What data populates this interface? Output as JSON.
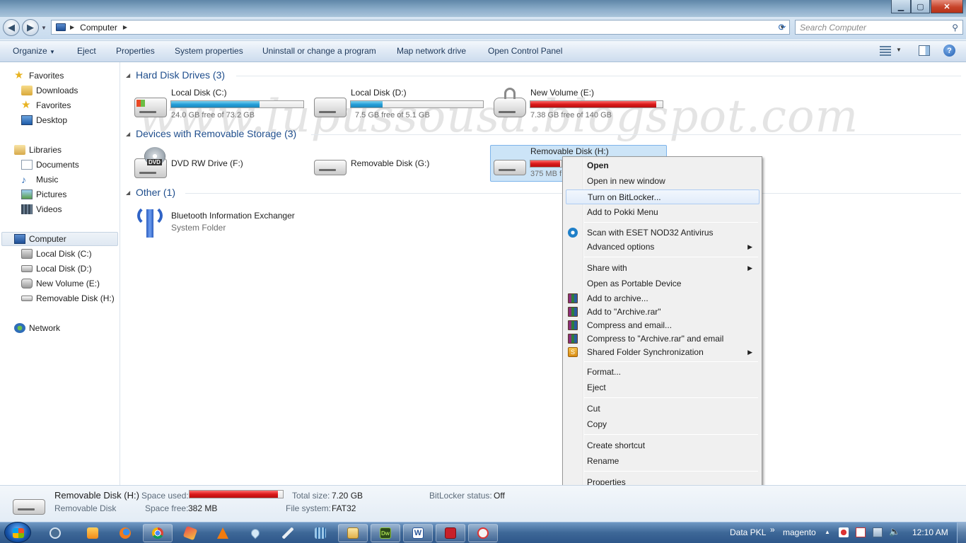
{
  "window": {
    "minimize_glyph": "▁",
    "maximize_glyph": "▢",
    "close_glyph": "✕"
  },
  "address": {
    "back_glyph": "◀",
    "forward_glyph": "▶",
    "path_label": "Computer",
    "search_placeholder": "Search Computer"
  },
  "toolbar": {
    "organize": "Organize",
    "eject": "Eject",
    "properties": "Properties",
    "system_properties": "System properties",
    "uninstall": "Uninstall or change a program",
    "map_drive": "Map network drive",
    "control_panel": "Open Control Panel",
    "help_glyph": "?"
  },
  "nav": {
    "favorites": "Favorites",
    "downloads": "Downloads",
    "favorites_sub": "Favorites",
    "desktop": "Desktop",
    "libraries": "Libraries",
    "documents": "Documents",
    "music": "Music",
    "pictures": "Pictures",
    "videos": "Videos",
    "computer": "Computer",
    "local_c": "Local Disk (C:)",
    "local_d": "Local Disk (D:)",
    "new_volume_e": "New Volume (E:)",
    "removable_h": "Removable Disk (H:)",
    "network": "Network"
  },
  "groups": {
    "hard_disks": "Hard Disk Drives (3)",
    "removable": "Devices with Removable Storage (3)",
    "other": "Other (1)"
  },
  "drives": {
    "c": {
      "name": "Local Disk (C:)",
      "free": "24.0 GB free of 73.2 GB",
      "used_fraction": 0.67,
      "color": "#26a0da"
    },
    "d": {
      "name": "Local Disk (D:)",
      "free": "7.5 GB free of 5.1 GB",
      "used_fraction": 0.24,
      "color": "#26a0da"
    },
    "e": {
      "name": "New Volume (E:)",
      "free": "7.38 GB free of 140 GB",
      "used_fraction": 0.95,
      "color": "#da1a1a"
    },
    "f": {
      "name": "DVD RW Drive (F:)",
      "icon_label": "DVD"
    },
    "g": {
      "name": "Removable Disk (G:)"
    },
    "h": {
      "name": "Removable Disk (H:)",
      "free": "375 MB f",
      "used_fraction": 0.95,
      "color": "#da1a1a"
    }
  },
  "other_items": {
    "bluetooth_name": "Bluetooth Information Exchanger",
    "bluetooth_type": "System Folder"
  },
  "watermark": "www.lupussousa.blogspot.com",
  "context_menu": {
    "open": "Open",
    "open_new_window": "Open in new window",
    "bitlocker": "Turn on BitLocker...",
    "pokki": "Add to Pokki Menu",
    "eset": "Scan with ESET NOD32 Antivirus",
    "advanced": "Advanced options",
    "share_with": "Share with",
    "portable": "Open as Portable Device",
    "add_archive": "Add to archive...",
    "add_archive_rar": "Add to \"Archive.rar\"",
    "compress_email": "Compress and email...",
    "compress_rar_email": "Compress to \"Archive.rar\" and email",
    "shared_sync": "Shared Folder Synchronization",
    "format": "Format...",
    "eject": "Eject",
    "cut": "Cut",
    "copy": "Copy",
    "create_shortcut": "Create shortcut",
    "rename": "Rename",
    "properties": "Properties",
    "submenu_glyph": "▶"
  },
  "details": {
    "name": "Removable Disk (H:)",
    "type": "Removable Disk",
    "space_used_label": "Space used:",
    "space_used_fraction": 0.95,
    "space_free_label": "Space free:",
    "space_free": "382 MB",
    "total_size_label": "Total size:",
    "total_size": "7.20 GB",
    "file_system_label": "File system:",
    "file_system": "FAT32",
    "bitlocker_label": "BitLocker status:",
    "bitlocker_value": "Off"
  },
  "taskbar": {
    "tray_label_1": "Data PKL",
    "tray_sep": "»",
    "tray_label_2": "magento",
    "clock": "12:10 AM",
    "dw_label": "Dw",
    "word_label": "W"
  }
}
